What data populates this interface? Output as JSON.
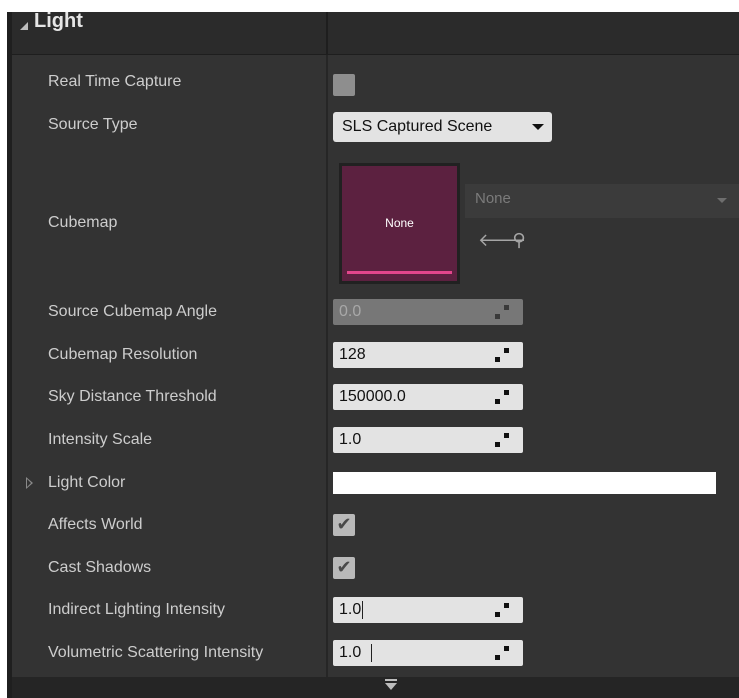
{
  "section": {
    "title": "Light"
  },
  "rows": {
    "real_time_capture": {
      "label": "Real Time Capture",
      "checked": false
    },
    "source_type": {
      "label": "Source Type",
      "value": "SLS Captured Scene"
    },
    "cubemap": {
      "label": "Cubemap",
      "thumbnail_text": "None",
      "asset_value": "None"
    },
    "source_cubemap_angle": {
      "label": "Source Cubemap Angle",
      "value": "0.0"
    },
    "cubemap_resolution": {
      "label": "Cubemap Resolution",
      "value": "128"
    },
    "sky_distance_threshold": {
      "label": "Sky Distance Threshold",
      "value": "150000.0"
    },
    "intensity_scale": {
      "label": "Intensity Scale",
      "value": "1.0"
    },
    "light_color": {
      "label": "Light Color",
      "color": "#ffffff"
    },
    "affects_world": {
      "label": "Affects World",
      "checked": true
    },
    "cast_shadows": {
      "label": "Cast Shadows",
      "checked": true
    },
    "indirect_lighting_intensity": {
      "label": "Indirect Lighting Intensity",
      "value": "1.0"
    },
    "volumetric_scattering_intensity": {
      "label": "Volumetric Scattering Intensity",
      "value": "1.0"
    }
  },
  "icons": {
    "checkmark": "✔",
    "use_selected": "🡐",
    "browse": "⚲"
  },
  "colors": {
    "panel_bg": "#333333",
    "cubemap_thumb": "#5c2140",
    "cubemap_accent": "#e2468c"
  }
}
